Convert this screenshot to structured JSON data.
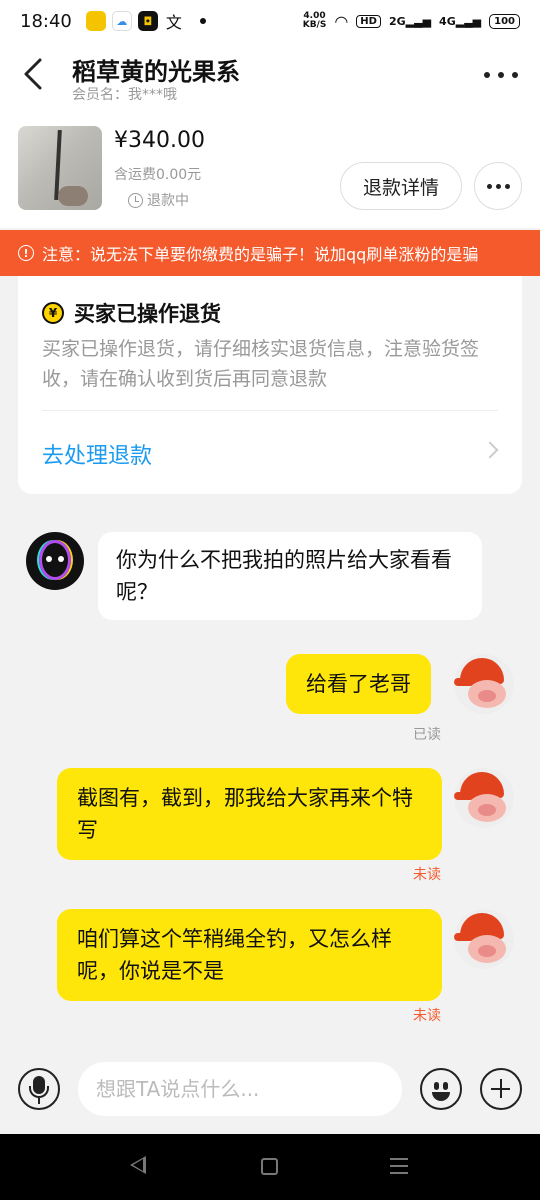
{
  "status_bar": {
    "time": "18:40",
    "speed_value": "4.00",
    "speed_unit": "KB/S",
    "hd_label": "HD",
    "net1": "2G",
    "net2": "4G",
    "battery": "100"
  },
  "header": {
    "shop_name": "稻草黄的光果系",
    "member_label": "会员名：我***哦"
  },
  "product": {
    "price": "¥340.00",
    "shipping": "含运费0.00元",
    "status": "退款中",
    "refund_detail_button": "退款详情"
  },
  "notice": {
    "text": "注意：说无法下单要你缴费的是骗子！说加qq刷单涨粉的是骗"
  },
  "refund_card": {
    "title": "买家已操作退货",
    "description": "买家已操作退货，请仔细核实退货信息，注意验货签收，请在确认收到货后再同意退款",
    "action": "去处理退款"
  },
  "messages": [
    {
      "side": "left",
      "text": "你为什么不把我拍的照片给大家看看呢？"
    },
    {
      "side": "right",
      "text": "给看了老哥",
      "status": "已读"
    },
    {
      "side": "right",
      "text": "截图有，截到，那我给大家再来个特写",
      "status": "未读"
    },
    {
      "side": "right",
      "text": "咱们算这个竿稍绳全钓，又怎么样呢，你说是不是",
      "status": "未读"
    }
  ],
  "composer": {
    "placeholder": "想跟TA说点什么..."
  },
  "colors": {
    "accent_yellow": "#ffe60a",
    "notice_red": "#f55a2c",
    "link_blue": "#1a9bf0",
    "unread_red": "#f55a2c",
    "read_gray": "#999999"
  }
}
